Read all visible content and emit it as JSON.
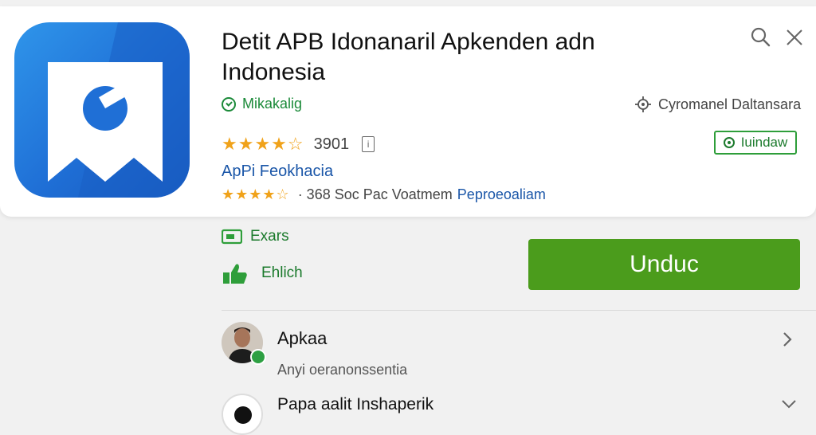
{
  "header": {
    "title_line1": "Detit APB Idonanaril Apkenden adn",
    "title_line2": "Indonesia"
  },
  "developer": {
    "name": "Mikakalig"
  },
  "category": {
    "label": "Cyromanel Daltansara"
  },
  "rating": {
    "stars": "★★★★☆",
    "value": "3901"
  },
  "install_chip": {
    "label": "Iuindaw"
  },
  "publisher_link": {
    "label": "ApPi Feokhacia"
  },
  "rating_detail": {
    "stars": "★★★★☆",
    "meta": "· 368 Soc Pac Voatmem",
    "link": "Peproeoaliam"
  },
  "features": [
    {
      "label": "Exars",
      "icon": "video-icon"
    },
    {
      "label": "Ehlich",
      "icon": "thumb-icon"
    }
  ],
  "download_button": {
    "label": "Unduc"
  },
  "reviews": [
    {
      "name": "Apkaa",
      "text": "Anyi oeranonssentia"
    },
    {
      "name": "Papa aalit Inshaperik",
      "text": ""
    }
  ],
  "colors": {
    "accent_green": "#4b9c1c",
    "link_blue": "#1a56a8",
    "star": "#f0a21a"
  }
}
